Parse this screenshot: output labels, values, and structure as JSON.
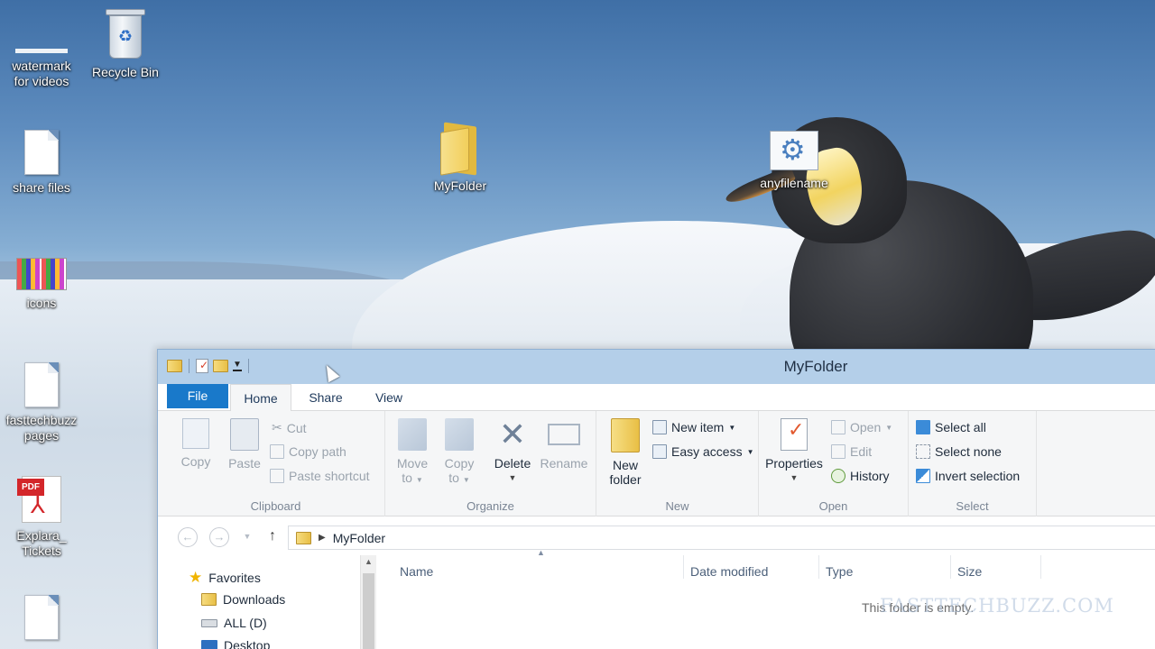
{
  "desktop": {
    "icons": [
      {
        "label": "watermark for videos",
        "icon": "watermark-file-icon"
      },
      {
        "label": "Recycle Bin",
        "icon": "recycle-bin-icon"
      },
      {
        "label": "share files",
        "icon": "document-icon"
      },
      {
        "label": "icons",
        "icon": "image-thumbnail-icon"
      },
      {
        "label": "fasttechbuzz pages",
        "icon": "document-icon"
      },
      {
        "label": "Explara_ Tickets",
        "icon": "pdf-icon"
      },
      {
        "label": "MyFolder",
        "icon": "folder-icon"
      },
      {
        "label": "anyfilename",
        "icon": "script-settings-icon"
      }
    ],
    "pdf_tag": "PDF"
  },
  "window": {
    "title": "MyFolder",
    "tabs": {
      "file": "File",
      "home": "Home",
      "share": "Share",
      "view": "View"
    },
    "ribbon": {
      "clipboard": {
        "label": "Clipboard",
        "copy": "Copy",
        "paste": "Paste",
        "cut": "Cut",
        "copy_path": "Copy path",
        "paste_shortcut": "Paste shortcut"
      },
      "organize": {
        "label": "Organize",
        "move_to_1": "Move",
        "move_to_2": "to",
        "copy_to_1": "Copy",
        "copy_to_2": "to",
        "delete": "Delete",
        "rename": "Rename"
      },
      "new": {
        "label": "New",
        "new_folder_1": "New",
        "new_folder_2": "folder",
        "new_item": "New item",
        "easy_access": "Easy access"
      },
      "open": {
        "label": "Open",
        "properties": "Properties",
        "open": "Open",
        "edit": "Edit",
        "history": "History"
      },
      "select": {
        "label": "Select",
        "select_all": "Select all",
        "select_none": "Select none",
        "invert_selection": "Invert selection"
      }
    },
    "address": {
      "crumb": "MyFolder"
    },
    "nav_pane": {
      "favorites": "Favorites",
      "downloads": "Downloads",
      "all_d": "ALL (D)",
      "desktop": "Desktop"
    },
    "columns": {
      "name": "Name",
      "date_modified": "Date modified",
      "type": "Type",
      "size": "Size"
    },
    "empty_message": "This folder is empty."
  },
  "watermark_brand": "FASTTECHBUZZ.COM",
  "colors": {
    "file_tab": "#1979ca",
    "titlebar": "#b4cfe9",
    "ribbon": "#f5f6f7"
  }
}
